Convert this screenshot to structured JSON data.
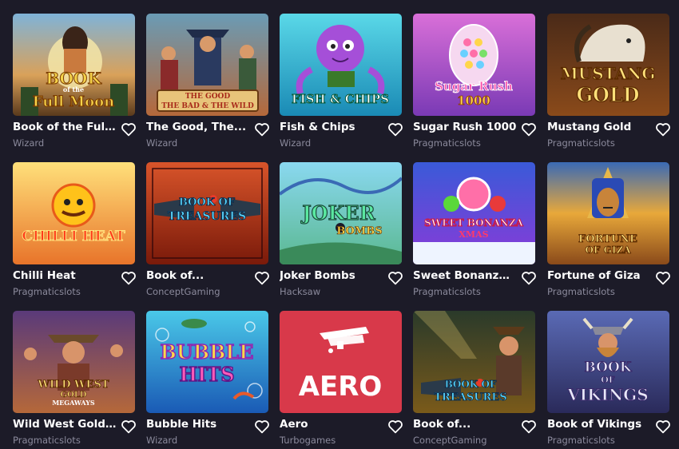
{
  "games": [
    {
      "title": "Book of the Full...",
      "provider": "Wizard",
      "art_text": [
        "BOOK",
        "of the",
        "Full Moon"
      ]
    },
    {
      "title": "The Good, The...",
      "provider": "Wizard",
      "art_text": [
        "THE GOOD",
        "THE BAD & THE WILD"
      ]
    },
    {
      "title": "Fish & Chips",
      "provider": "Wizard",
      "art_text": [
        "FISH & CHIPS"
      ]
    },
    {
      "title": "Sugar Rush 1000",
      "provider": "Pragmaticslots",
      "art_text": [
        "Sugar Rush",
        "1000"
      ]
    },
    {
      "title": "Mustang Gold",
      "provider": "Pragmaticslots",
      "art_text": [
        "MUSTANG",
        "GOLD"
      ]
    },
    {
      "title": "Chilli Heat",
      "provider": "Pragmaticslots",
      "art_text": [
        "CHILLI HEAT"
      ]
    },
    {
      "title": "Book of...",
      "provider": "ConceptGaming",
      "art_text": [
        "BOOK OF",
        "TREASURES"
      ]
    },
    {
      "title": "Joker Bombs",
      "provider": "Hacksaw",
      "art_text": [
        "JOKER",
        "BOMBS"
      ]
    },
    {
      "title": "Sweet Bonanza...",
      "provider": "Pragmaticslots",
      "art_text": [
        "SWEET BONANZA",
        "XMAS"
      ]
    },
    {
      "title": "Fortune of Giza",
      "provider": "Pragmaticslots",
      "art_text": [
        "FORTUNE",
        "OF GIZA"
      ]
    },
    {
      "title": "Wild West Gold...",
      "provider": "Pragmaticslots",
      "art_text": [
        "WILD WEST",
        "GOLD",
        "MEGAWAYS"
      ]
    },
    {
      "title": "Bubble Hits",
      "provider": "Wizard",
      "art_text": [
        "BUBBLE",
        "HITS"
      ]
    },
    {
      "title": "Aero",
      "provider": "Turbogames",
      "art_text": [
        "AERO"
      ]
    },
    {
      "title": "Book of...",
      "provider": "ConceptGaming",
      "art_text": [
        "BOOK OF",
        "TREASURES"
      ]
    },
    {
      "title": "Book of Vikings",
      "provider": "Pragmaticslots",
      "art_text": [
        "BOOK",
        "OF",
        "VIKINGS"
      ]
    }
  ],
  "icons": {
    "favorite": "heart-outline-icon"
  },
  "colors": {
    "background": "#1c1b28",
    "title": "#ffffff",
    "provider": "#8b8a9c"
  }
}
